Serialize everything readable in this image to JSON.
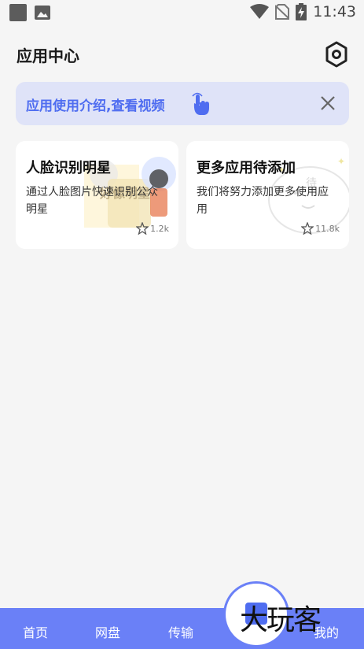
{
  "status_bar": {
    "time": "11:43",
    "icons": [
      "square-icon",
      "image-icon",
      "wifi-icon",
      "no-sim-icon",
      "battery-icon"
    ]
  },
  "header": {
    "title": "应用中心",
    "settings_icon": "gear-hexagon-icon"
  },
  "banner": {
    "text": "应用使用介绍,查看视频",
    "accent": "#4f6df0",
    "background": "#dfe3f8"
  },
  "cards": [
    {
      "title": "人脸识别明星",
      "description": "通过人脸图片快速识别公众明星",
      "likes": "1.2k",
      "illustration_text": "好像明星"
    },
    {
      "title": "更多应用待添加",
      "description": "我们将努力添加更多使用应用",
      "likes": "11.8k",
      "illustration_text": "待"
    }
  ],
  "bottom_nav": {
    "items": [
      "首页",
      "网盘",
      "传输",
      "我的"
    ],
    "color": "#6a80f7",
    "watermark": "大玩客"
  }
}
